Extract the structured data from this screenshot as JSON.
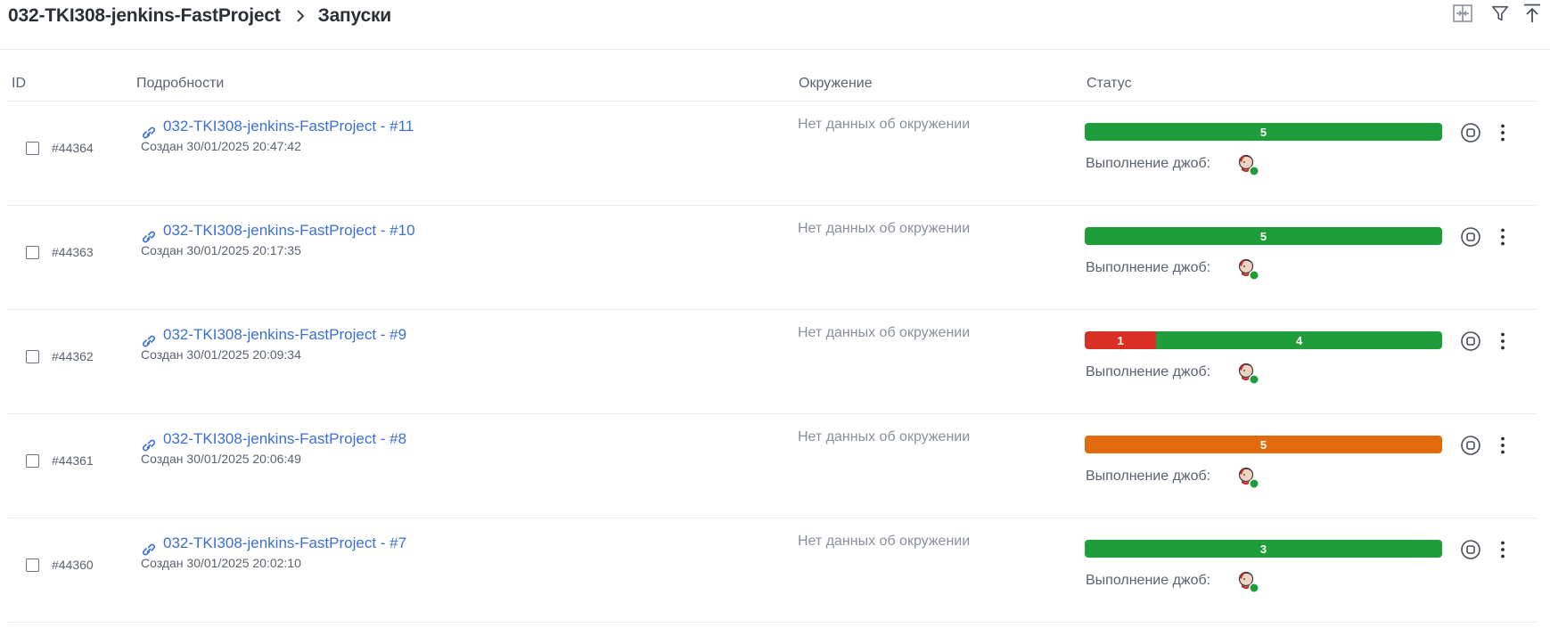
{
  "breadcrumb": {
    "project": "032-TKI308-jenkins-FastProject",
    "current": "Запуски"
  },
  "toolbar": {
    "icons": [
      "split-view-icon",
      "filter-icon",
      "scroll-top-icon"
    ]
  },
  "columns": {
    "id": "ID",
    "details": "Подробности",
    "environment": "Окружение",
    "status": "Статус"
  },
  "colors": {
    "success": "#1f9d3a",
    "failed": "#d93025",
    "warning": "#e06a0c",
    "link": "#3b6fd4"
  },
  "runs": [
    {
      "id": "#44364",
      "title": "032-TKI308-jenkins-FastProject - #11",
      "created": "Создан 30/01/2025 20:47:42",
      "environment": "Нет данных об окружении",
      "status": {
        "segments": [
          {
            "kind": "success",
            "value": "5"
          }
        ]
      },
      "jobs_label": "Выполнение джоб:"
    },
    {
      "id": "#44363",
      "title": "032-TKI308-jenkins-FastProject - #10",
      "created": "Создан 30/01/2025 20:17:35",
      "environment": "Нет данных об окружении",
      "status": {
        "segments": [
          {
            "kind": "success",
            "value": "5"
          }
        ]
      },
      "jobs_label": "Выполнение джоб:"
    },
    {
      "id": "#44362",
      "title": "032-TKI308-jenkins-FastProject - #9",
      "created": "Создан 30/01/2025 20:09:34",
      "environment": "Нет данных об окружении",
      "status": {
        "segments": [
          {
            "kind": "failed",
            "value": "1"
          },
          {
            "kind": "success",
            "value": "4"
          }
        ]
      },
      "jobs_label": "Выполнение джоб:"
    },
    {
      "id": "#44361",
      "title": "032-TKI308-jenkins-FastProject - #8",
      "created": "Создан 30/01/2025 20:06:49",
      "environment": "Нет данных об окружении",
      "status": {
        "segments": [
          {
            "kind": "warning",
            "value": "5"
          }
        ]
      },
      "jobs_label": "Выполнение джоб:"
    },
    {
      "id": "#44360",
      "title": "032-TKI308-jenkins-FastProject - #7",
      "created": "Создан 30/01/2025 20:02:10",
      "environment": "Нет данных об окружении",
      "status": {
        "segments": [
          {
            "kind": "success",
            "value": "3"
          }
        ]
      },
      "jobs_label": "Выполнение джоб:"
    }
  ]
}
